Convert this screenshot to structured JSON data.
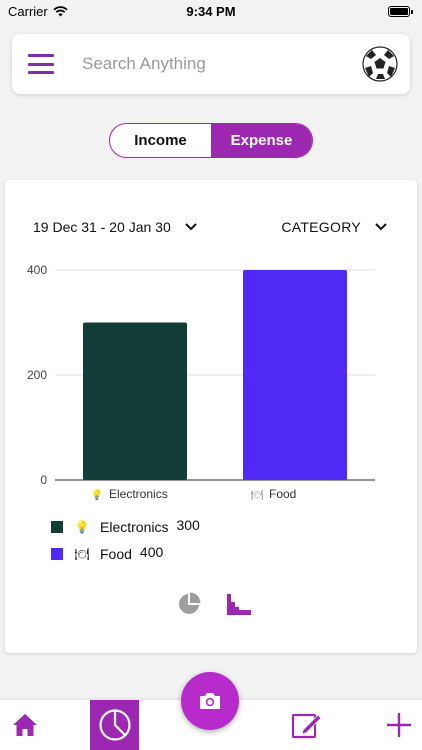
{
  "status_bar": {
    "carrier": "Carrier",
    "time": "9:34 PM"
  },
  "search": {
    "placeholder": "Search Anything"
  },
  "toggle": {
    "income_label": "Income",
    "expense_label": "Expense",
    "selected": "Expense"
  },
  "filters": {
    "date_range": "19 Dec 31 - 20 Jan 30",
    "group_by": "CATEGORY"
  },
  "colors": {
    "accent": "#9c27b0",
    "electronics": "#133d37",
    "food": "#5029f5"
  },
  "chart_data": {
    "type": "bar",
    "categories": [
      "Electronics",
      "Food"
    ],
    "category_icons": [
      "💡",
      "🍽"
    ],
    "values": [
      300,
      400
    ],
    "colors": [
      "#133d37",
      "#5029f5"
    ],
    "ylim": [
      0,
      400
    ],
    "yticks": [
      0,
      200,
      400
    ],
    "grid": true,
    "legend_placement": "bottom-left",
    "title": "",
    "xlabel": "",
    "ylabel": ""
  },
  "legend": [
    {
      "icon": "💡",
      "label": "Electronics",
      "value": "300"
    },
    {
      "icon": "🍽",
      "label": "Food",
      "value": "400"
    }
  ],
  "chart_types": [
    "pie-chart-icon",
    "bar-chart-icon"
  ],
  "bottom_nav": [
    "home-icon",
    "stats-icon",
    "camera-icon",
    "edit-icon",
    "add-icon"
  ]
}
